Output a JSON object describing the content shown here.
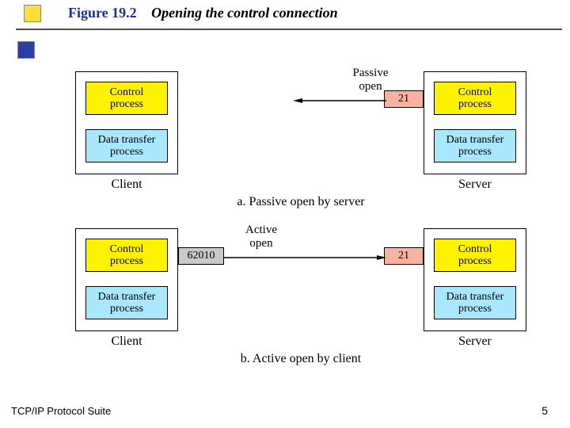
{
  "header": {
    "figure": "Figure 19.2",
    "title": "Opening the control connection"
  },
  "proc": {
    "control": "Control\nprocess",
    "data": "Data transfer\nprocess"
  },
  "host": {
    "client": "Client",
    "server": "Server"
  },
  "top": {
    "open_label": "Passive\nopen",
    "port_server": "21",
    "caption": "a. Passive open by server"
  },
  "bottom": {
    "open_label": "Active\nopen",
    "port_client": "62010",
    "port_server": "21",
    "caption": "b. Active open by client"
  },
  "footer": {
    "left": "TCP/IP Protocol Suite",
    "page": "5"
  }
}
